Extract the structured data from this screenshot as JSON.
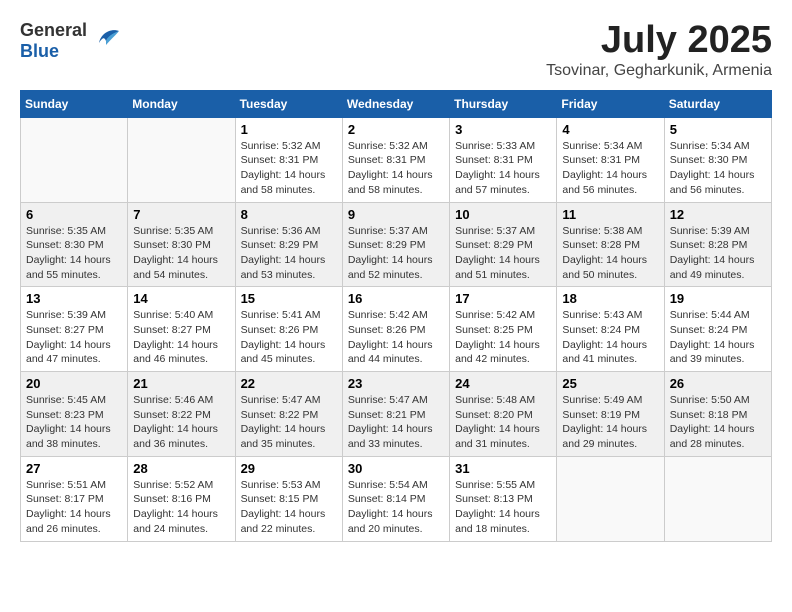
{
  "logo": {
    "general": "General",
    "blue": "Blue"
  },
  "title": "July 2025",
  "subtitle": "Tsovinar, Gegharkunik, Armenia",
  "days_of_week": [
    "Sunday",
    "Monday",
    "Tuesday",
    "Wednesday",
    "Thursday",
    "Friday",
    "Saturday"
  ],
  "weeks": [
    {
      "shaded": false,
      "days": [
        {
          "num": "",
          "info": ""
        },
        {
          "num": "",
          "info": ""
        },
        {
          "num": "1",
          "info": "Sunrise: 5:32 AM\nSunset: 8:31 PM\nDaylight: 14 hours\nand 58 minutes."
        },
        {
          "num": "2",
          "info": "Sunrise: 5:32 AM\nSunset: 8:31 PM\nDaylight: 14 hours\nand 58 minutes."
        },
        {
          "num": "3",
          "info": "Sunrise: 5:33 AM\nSunset: 8:31 PM\nDaylight: 14 hours\nand 57 minutes."
        },
        {
          "num": "4",
          "info": "Sunrise: 5:34 AM\nSunset: 8:31 PM\nDaylight: 14 hours\nand 56 minutes."
        },
        {
          "num": "5",
          "info": "Sunrise: 5:34 AM\nSunset: 8:30 PM\nDaylight: 14 hours\nand 56 minutes."
        }
      ]
    },
    {
      "shaded": true,
      "days": [
        {
          "num": "6",
          "info": "Sunrise: 5:35 AM\nSunset: 8:30 PM\nDaylight: 14 hours\nand 55 minutes."
        },
        {
          "num": "7",
          "info": "Sunrise: 5:35 AM\nSunset: 8:30 PM\nDaylight: 14 hours\nand 54 minutes."
        },
        {
          "num": "8",
          "info": "Sunrise: 5:36 AM\nSunset: 8:29 PM\nDaylight: 14 hours\nand 53 minutes."
        },
        {
          "num": "9",
          "info": "Sunrise: 5:37 AM\nSunset: 8:29 PM\nDaylight: 14 hours\nand 52 minutes."
        },
        {
          "num": "10",
          "info": "Sunrise: 5:37 AM\nSunset: 8:29 PM\nDaylight: 14 hours\nand 51 minutes."
        },
        {
          "num": "11",
          "info": "Sunrise: 5:38 AM\nSunset: 8:28 PM\nDaylight: 14 hours\nand 50 minutes."
        },
        {
          "num": "12",
          "info": "Sunrise: 5:39 AM\nSunset: 8:28 PM\nDaylight: 14 hours\nand 49 minutes."
        }
      ]
    },
    {
      "shaded": false,
      "days": [
        {
          "num": "13",
          "info": "Sunrise: 5:39 AM\nSunset: 8:27 PM\nDaylight: 14 hours\nand 47 minutes."
        },
        {
          "num": "14",
          "info": "Sunrise: 5:40 AM\nSunset: 8:27 PM\nDaylight: 14 hours\nand 46 minutes."
        },
        {
          "num": "15",
          "info": "Sunrise: 5:41 AM\nSunset: 8:26 PM\nDaylight: 14 hours\nand 45 minutes."
        },
        {
          "num": "16",
          "info": "Sunrise: 5:42 AM\nSunset: 8:26 PM\nDaylight: 14 hours\nand 44 minutes."
        },
        {
          "num": "17",
          "info": "Sunrise: 5:42 AM\nSunset: 8:25 PM\nDaylight: 14 hours\nand 42 minutes."
        },
        {
          "num": "18",
          "info": "Sunrise: 5:43 AM\nSunset: 8:24 PM\nDaylight: 14 hours\nand 41 minutes."
        },
        {
          "num": "19",
          "info": "Sunrise: 5:44 AM\nSunset: 8:24 PM\nDaylight: 14 hours\nand 39 minutes."
        }
      ]
    },
    {
      "shaded": true,
      "days": [
        {
          "num": "20",
          "info": "Sunrise: 5:45 AM\nSunset: 8:23 PM\nDaylight: 14 hours\nand 38 minutes."
        },
        {
          "num": "21",
          "info": "Sunrise: 5:46 AM\nSunset: 8:22 PM\nDaylight: 14 hours\nand 36 minutes."
        },
        {
          "num": "22",
          "info": "Sunrise: 5:47 AM\nSunset: 8:22 PM\nDaylight: 14 hours\nand 35 minutes."
        },
        {
          "num": "23",
          "info": "Sunrise: 5:47 AM\nSunset: 8:21 PM\nDaylight: 14 hours\nand 33 minutes."
        },
        {
          "num": "24",
          "info": "Sunrise: 5:48 AM\nSunset: 8:20 PM\nDaylight: 14 hours\nand 31 minutes."
        },
        {
          "num": "25",
          "info": "Sunrise: 5:49 AM\nSunset: 8:19 PM\nDaylight: 14 hours\nand 29 minutes."
        },
        {
          "num": "26",
          "info": "Sunrise: 5:50 AM\nSunset: 8:18 PM\nDaylight: 14 hours\nand 28 minutes."
        }
      ]
    },
    {
      "shaded": false,
      "days": [
        {
          "num": "27",
          "info": "Sunrise: 5:51 AM\nSunset: 8:17 PM\nDaylight: 14 hours\nand 26 minutes."
        },
        {
          "num": "28",
          "info": "Sunrise: 5:52 AM\nSunset: 8:16 PM\nDaylight: 14 hours\nand 24 minutes."
        },
        {
          "num": "29",
          "info": "Sunrise: 5:53 AM\nSunset: 8:15 PM\nDaylight: 14 hours\nand 22 minutes."
        },
        {
          "num": "30",
          "info": "Sunrise: 5:54 AM\nSunset: 8:14 PM\nDaylight: 14 hours\nand 20 minutes."
        },
        {
          "num": "31",
          "info": "Sunrise: 5:55 AM\nSunset: 8:13 PM\nDaylight: 14 hours\nand 18 minutes."
        },
        {
          "num": "",
          "info": ""
        },
        {
          "num": "",
          "info": ""
        }
      ]
    }
  ]
}
